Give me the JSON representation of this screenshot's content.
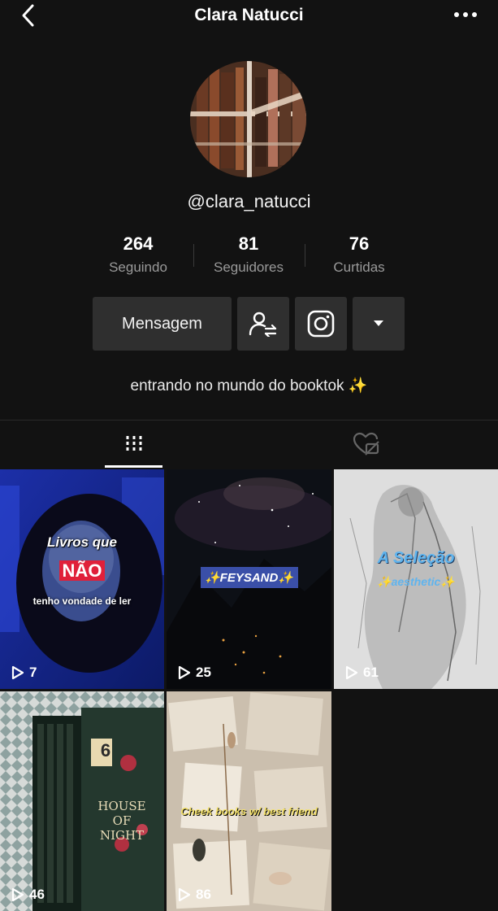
{
  "header": {
    "title": "Clara Natucci"
  },
  "profile": {
    "handle": "@clara_natucci",
    "stats": [
      {
        "value": "264",
        "label": "Seguindo"
      },
      {
        "value": "81",
        "label": "Seguidores"
      },
      {
        "value": "76",
        "label": "Curtidas"
      }
    ],
    "message_label": "Mensagem",
    "bio": "entrando no mundo do booktok",
    "bio_emoji": "✨"
  },
  "videos": [
    {
      "views": "7",
      "caption_lines": [
        "Livros que",
        "NÃO",
        "tenho vondade de ler"
      ]
    },
    {
      "views": "25",
      "caption": "✨FEYSAND✨"
    },
    {
      "views": "61",
      "caption_lines": [
        "A Seleção",
        "✨aesthetic✨"
      ]
    },
    {
      "views": "46",
      "cover_text": "HOUSE OF NIGHT",
      "cover_number": "6"
    },
    {
      "views": "86",
      "caption": "Cheek books w/ best friend"
    }
  ],
  "colors": {
    "background": "#121212",
    "button": "#2f2f2f",
    "muted_text": "#9a9a9a"
  }
}
